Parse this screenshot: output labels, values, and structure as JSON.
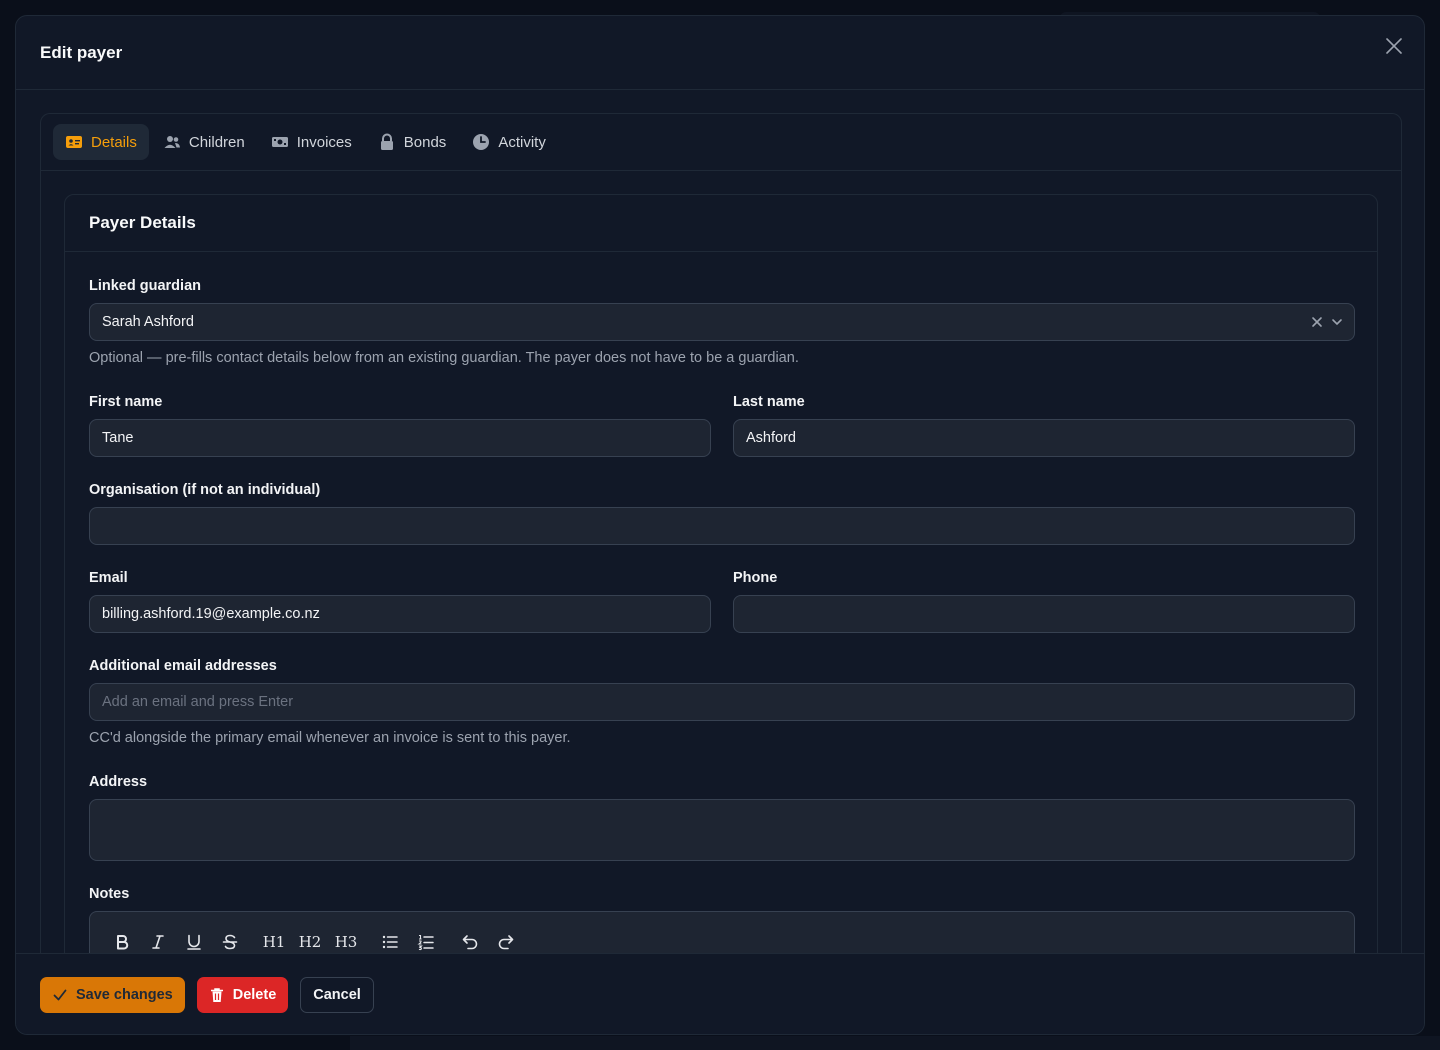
{
  "modal": {
    "title": "Edit payer"
  },
  "tabs": [
    {
      "label": "Details",
      "icon": "id-card-icon",
      "active": true
    },
    {
      "label": "Children",
      "icon": "users-icon"
    },
    {
      "label": "Invoices",
      "icon": "banknote-icon"
    },
    {
      "label": "Bonds",
      "icon": "lock-icon"
    },
    {
      "label": "Activity",
      "icon": "clock-icon"
    }
  ],
  "section": {
    "title": "Payer Details"
  },
  "form": {
    "linked_guardian": {
      "label": "Linked guardian",
      "value": "Sarah Ashford",
      "hint": "Optional — pre-fills contact details below from an existing guardian. The payer does not have to be a guardian."
    },
    "first_name": {
      "label": "First name",
      "value": "Tane"
    },
    "last_name": {
      "label": "Last name",
      "value": "Ashford"
    },
    "organisation": {
      "label": "Organisation (if not an individual)",
      "value": ""
    },
    "email": {
      "label": "Email",
      "value": "billing.ashford.19@example.co.nz"
    },
    "phone": {
      "label": "Phone",
      "value": ""
    },
    "additional_emails": {
      "label": "Additional email addresses",
      "placeholder": "Add an email and press Enter",
      "hint": "CC'd alongside the primary email whenever an invoice is sent to this payer."
    },
    "address": {
      "label": "Address",
      "value": ""
    },
    "notes": {
      "label": "Notes"
    }
  },
  "toolbar": {
    "h1": "H1",
    "h2": "H2",
    "h3": "H3"
  },
  "footer": {
    "save_label": "Save changes",
    "delete_label": "Delete",
    "cancel_label": "Cancel"
  },
  "colors": {
    "accent": "#f59e0b",
    "save": "#d97706",
    "delete": "#dc2626",
    "background": "#111827"
  }
}
